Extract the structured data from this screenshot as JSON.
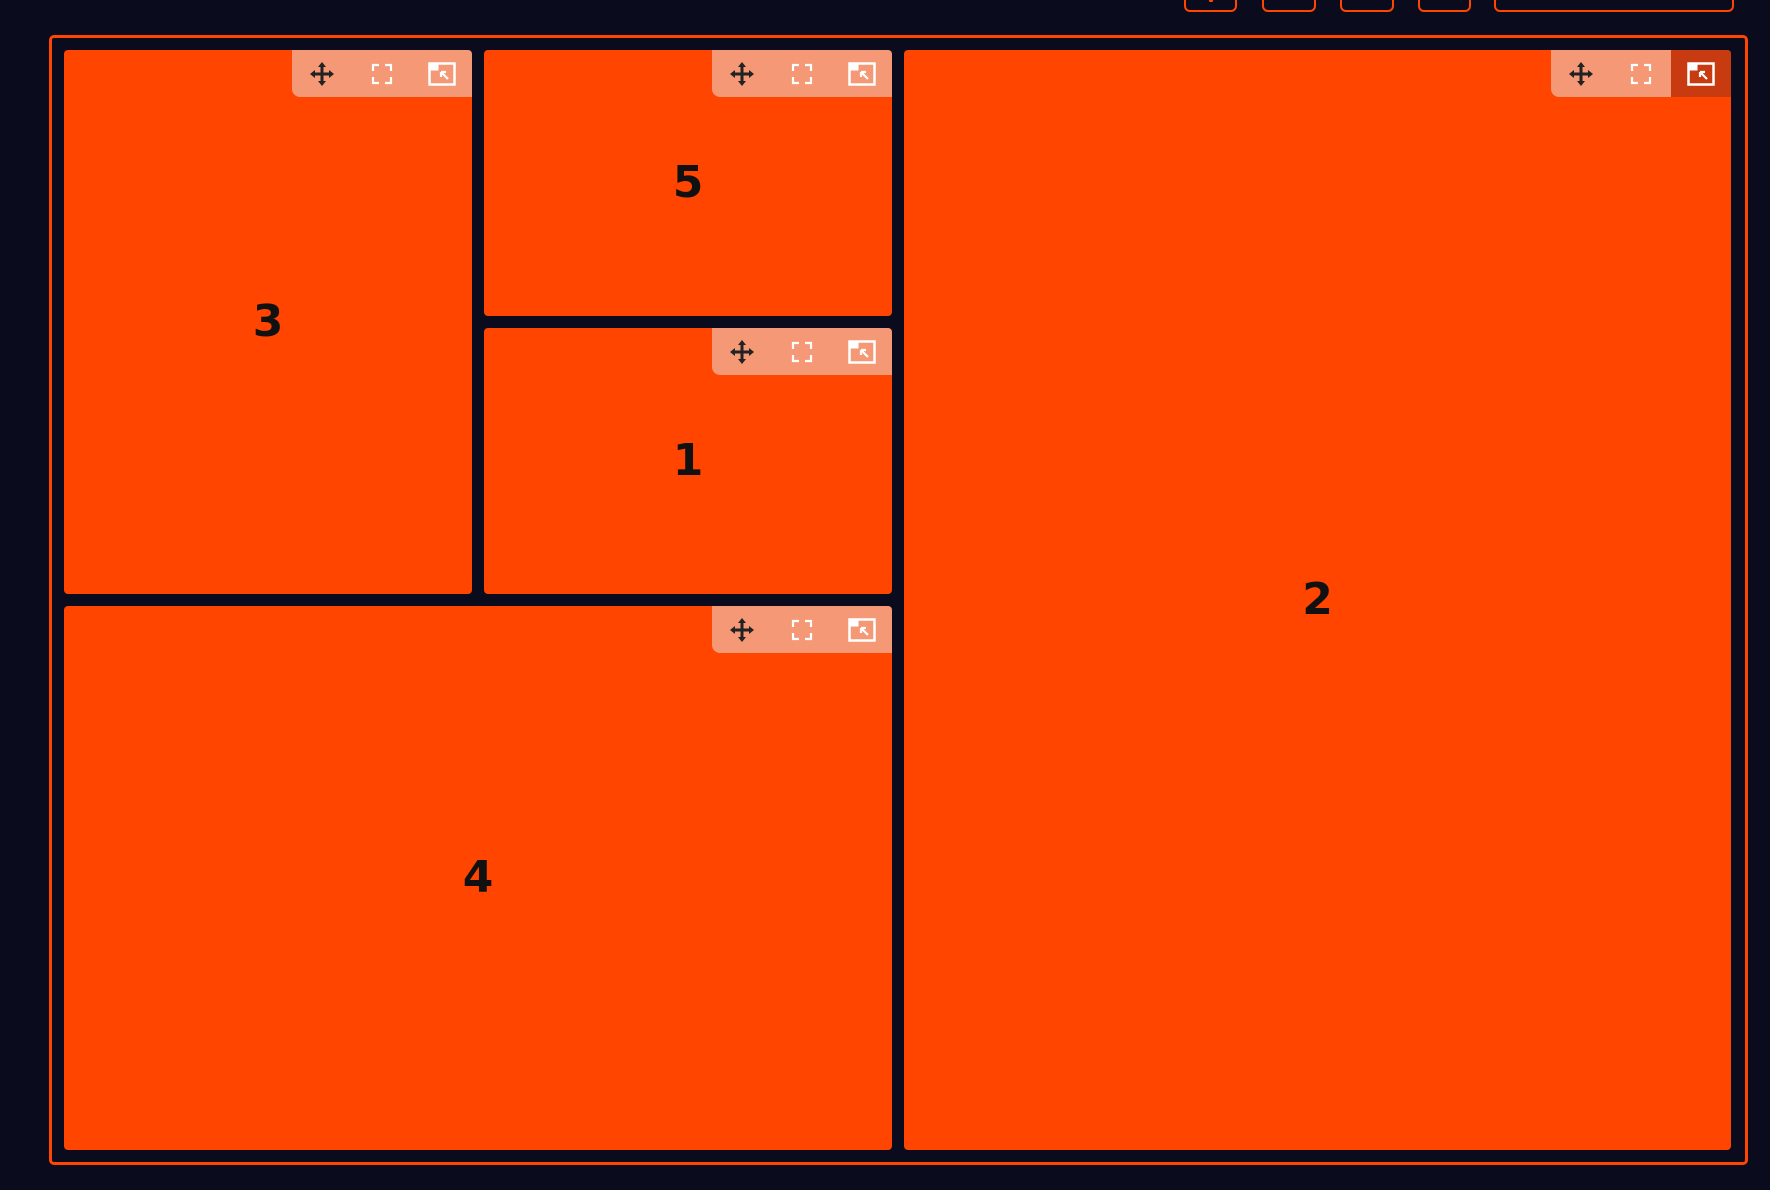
{
  "colors": {
    "background": "#0b0b1e",
    "accent": "#ff4500",
    "panel": "#ff4500",
    "toolbar_overlay": "rgba(236,236,236,0.5)",
    "active_button": "#c83a10"
  },
  "top_toolbar": {
    "buttons": [
      {
        "name": "toolbar-button-1"
      },
      {
        "name": "toolbar-button-2"
      },
      {
        "name": "toolbar-button-3"
      },
      {
        "name": "toolbar-button-4"
      },
      {
        "name": "toolbar-input"
      }
    ]
  },
  "panel_toolbar": {
    "icons": [
      "move-icon",
      "fullscreen-icon",
      "popout-icon"
    ]
  },
  "panels": [
    {
      "id": "panel-3",
      "label": "3",
      "active_popout": false
    },
    {
      "id": "panel-5",
      "label": "5",
      "active_popout": false
    },
    {
      "id": "panel-1",
      "label": "1",
      "active_popout": false
    },
    {
      "id": "panel-4",
      "label": "4",
      "active_popout": false
    },
    {
      "id": "panel-2",
      "label": "2",
      "active_popout": true
    }
  ]
}
